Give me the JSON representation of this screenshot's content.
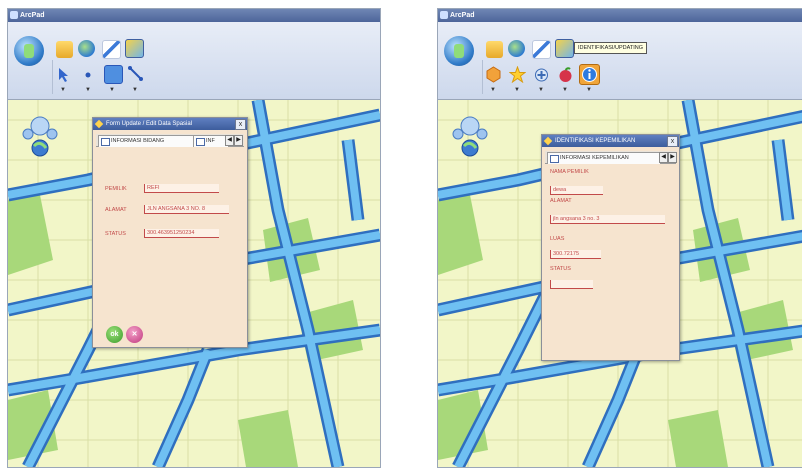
{
  "left_window": {
    "title": "ArcPad",
    "dialog": {
      "title": "Form Update / Edit Data Spasial",
      "close_label": "x",
      "tabs": [
        "INFORMASI BIDANG",
        "INF"
      ],
      "tab_prev": "◀",
      "tab_next": "▶",
      "fields": [
        {
          "label": "PEMILIK",
          "value": "REFI"
        },
        {
          "label": "ALAMAT",
          "value": "JLN ANGSANA 3 NO. 8"
        },
        {
          "label": "STATUS",
          "value": "300.463951250234"
        }
      ],
      "ok_label": "ok",
      "cancel_label": "✕"
    }
  },
  "right_window": {
    "title": "ArcPad",
    "tooltip": "IDENTIFIKASI/UPDATING",
    "dialog": {
      "title": "IDENTIFIKASI KEPEMILIKAN",
      "close_label": "x",
      "tabs": [
        "INFORMASI KEPEMILIKAN"
      ],
      "tab_prev": "◀",
      "tab_next": "▶",
      "fields": [
        {
          "label": "NAMA PEMILIK",
          "value": "dewa"
        },
        {
          "label": "ALAMAT",
          "value": "jln angsana 3 no. 3"
        },
        {
          "label": "LUAS",
          "value": "300.72175"
        },
        {
          "label": "STATUS",
          "value": ""
        }
      ]
    }
  },
  "icons": {
    "left_toolbar": [
      "folder-icon",
      "globe-icon",
      "scissors-pen-icon",
      "edit-map-icon",
      "select-arrow-icon",
      "point-icon",
      "table-icon",
      "line-tool-icon"
    ],
    "right_toolbar": [
      "folder-icon",
      "globe-icon",
      "scissors-pen-icon",
      "identify-map-icon",
      "hexagon-icon",
      "star-icon",
      "add-layer-icon",
      "apple-icon",
      "info-icon"
    ]
  },
  "colors": {
    "road": "#4aa3e6",
    "road_edge": "#2f6fbf",
    "block_light": "#f2f6c8",
    "block_green": "#a8d87a",
    "dialog_bg": "#f6e4cf",
    "field_text": "#c24a4a"
  }
}
